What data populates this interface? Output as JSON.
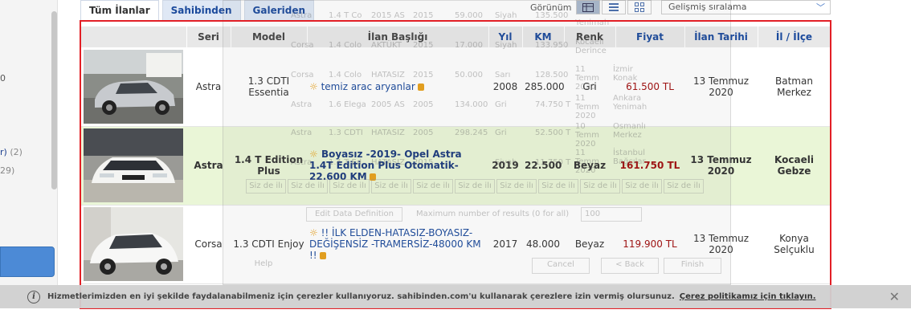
{
  "left_panel": {
    "frag1": "0",
    "frag2_link": "r)",
    "frag2_count": "(2)",
    "frag3": "29)"
  },
  "tabs": [
    {
      "label": "Tüm İlanlar"
    },
    {
      "label": "Sahibinden"
    },
    {
      "label": "Galeriden"
    }
  ],
  "view": {
    "label": "Görünüm"
  },
  "sort": {
    "label": "Gelişmiş sıralama"
  },
  "table": {
    "headers": {
      "seri": "Seri",
      "model": "Model",
      "baslik": "İlan Başlığı",
      "yil": "Yıl",
      "km": "KM",
      "renk": "Renk",
      "fiyat": "Fiyat",
      "tarih": "İlan Tarihi",
      "il": "İl / İlçe"
    },
    "rows": [
      {
        "seri": "Astra",
        "model": "1.3 CDTI Essentia",
        "title": "temiz arac aryanlar",
        "yil": "2008",
        "km": "285.000",
        "renk": "Gri",
        "fiyat": "61.500 TL",
        "tarih": "13 Temmuz 2020",
        "il": "Batman Merkez"
      },
      {
        "seri": "Astra",
        "model": "1.4 T Edition Plus",
        "title": "Boyasız -2019- Opel Astra 1.4T Edition Plus Otomatik- 22.600 KM",
        "yil": "2019",
        "km": "22.500",
        "renk": "Beyaz",
        "fiyat": "161.750 TL",
        "tarih": "13 Temmuz 2020",
        "il": "Kocaeli Gebze"
      },
      {
        "seri": "Corsa",
        "model": "1.3 CDTI Enjoy",
        "title": "!! İLK ELDEN-HATASIZ-BOYASIZ-DEĞİŞENSİZ -TRAMERSİZ-48000 KM !!",
        "yil": "2017",
        "km": "48.000",
        "renk": "Beyaz",
        "fiyat": "119.900 TL",
        "tarih": "13 Temmuz 2020",
        "il": "Konya Selçuklu"
      }
    ]
  },
  "ghost": {
    "rows": [
      [
        "Astra",
        "1.4 T Co",
        "2015 AS",
        "2015",
        "59.000",
        "Siyah",
        "135.500",
        "Yenimah"
      ],
      [
        "Corsa",
        "1.4 Colo",
        "AKTÜKT",
        "2015",
        "17.000",
        "Siyah",
        "133.950",
        "Kocaeli Derince"
      ],
      [
        "Corsa",
        "1.4 Colo",
        "HATASIZ",
        "2015",
        "50.000",
        "Sarı",
        "128.500",
        "11 Temm 2020",
        "İzmir Konak"
      ],
      [
        "Astra",
        "1.6 Elega",
        "2005 AS",
        "2005",
        "134.000",
        "Gri",
        "74.750 T",
        "11 Temm 2020",
        "Ankara Yenimah"
      ],
      [
        "Astra",
        "1.3 CDTI",
        "HATASIZ",
        "2005",
        "298.245",
        "Gri",
        "52.500 T",
        "10 Temm 2020",
        "Osmanlı Merkez"
      ],
      [
        "Astra",
        "1.4 T Ed",
        "HATASIZ",
        "2015",
        "Siyah",
        "11.750 T",
        "11 Temm 2020",
        "İstanbul Bağcılar"
      ]
    ],
    "placeholder": "Siz de ilı",
    "edit_btn": "Edit Data Definition",
    "max_label": "Maximum number of results (0 for all)",
    "max_value": "100",
    "help": "Help",
    "cancel": "Cancel",
    "back": "< Back",
    "finish": "Finish"
  },
  "cookie": {
    "text": "Hizmetlerimizden en iyi şekilde faydalanabilmeniz için çerezler kullanıyoruz. sahibinden.com'u kullanarak çerezlere izin vermiş olursunuz.",
    "link": "Çerez politikamız için tıklayın.",
    "close": "✕"
  }
}
